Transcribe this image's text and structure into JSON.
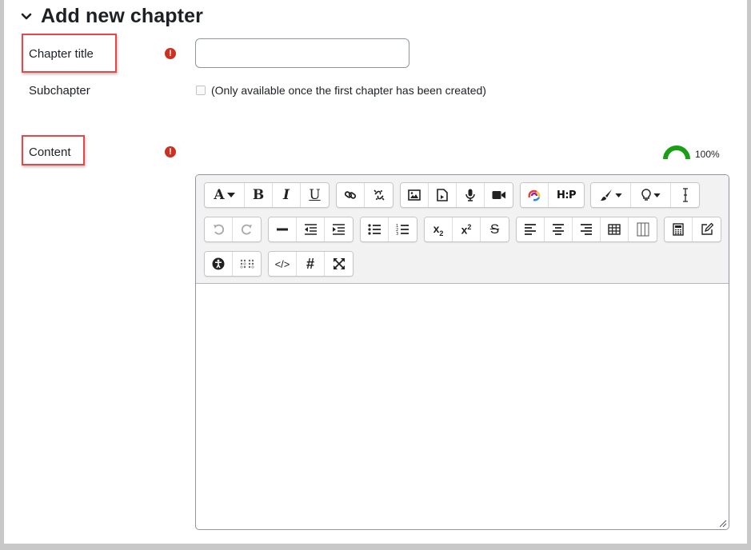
{
  "section": {
    "title": "Add new chapter",
    "collapse_icon": "chevron-down-icon"
  },
  "fields": {
    "chapter_title": {
      "label": "Chapter title",
      "required_icon": "exclamation-circle-icon",
      "value": "",
      "placeholder": ""
    },
    "subchapter": {
      "label": "Subchapter",
      "checked": false,
      "note": "(Only available once the first chapter has been created)"
    },
    "content": {
      "label": "Content",
      "required_icon": "exclamation-circle-icon"
    }
  },
  "accessibility_gauge": {
    "percent_text": "100%",
    "value": 1.0
  },
  "colors": {
    "required": "#ca3120",
    "gauge": "#1a9e16",
    "highlight": "#e8474a"
  },
  "toolbar": {
    "row1": [
      [
        "font-style-dropdown",
        "bold",
        "italic",
        "underline"
      ],
      [
        "link",
        "unlink"
      ],
      [
        "insert-image",
        "insert-media",
        "record-audio",
        "record-video"
      ],
      [
        "wiris-chemistry",
        "h5p"
      ],
      [
        "text-color-dropdown",
        "highlight-dropdown",
        "cursor-text"
      ]
    ],
    "row2": [
      [
        "undo",
        "redo"
      ],
      [
        "horizontal-rule",
        "outdent",
        "indent"
      ],
      [
        "bullet-list",
        "numbered-list"
      ],
      [
        "subscript",
        "superscript",
        "strikethrough"
      ],
      [
        "align-left",
        "align-center",
        "align-right",
        "table",
        "columns"
      ],
      [
        "calculator",
        "edit-note"
      ]
    ],
    "row3": [
      [
        "accessibility-checker",
        "braille-screenreader"
      ],
      [
        "html-source",
        "hashtag",
        "fullscreen"
      ]
    ]
  },
  "editor_content": ""
}
